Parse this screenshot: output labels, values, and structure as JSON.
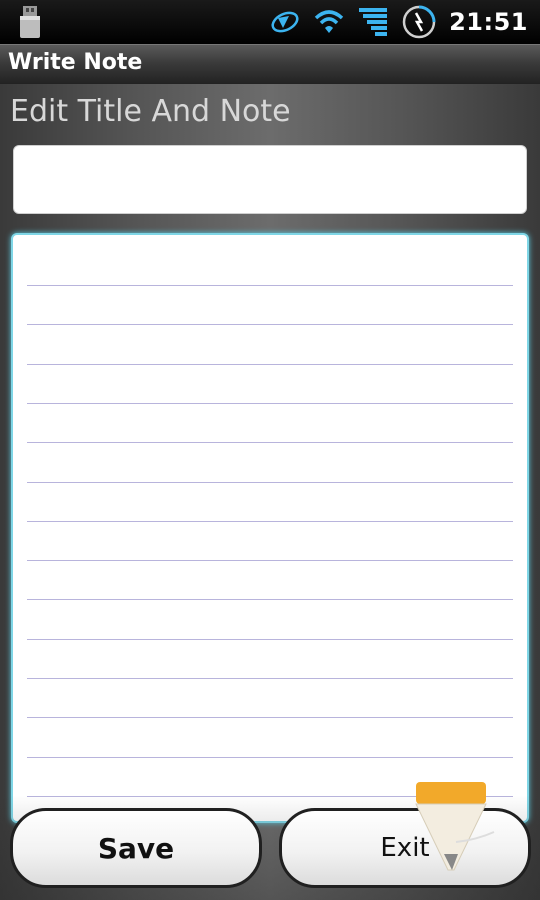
{
  "status_bar": {
    "time": "21:51",
    "icons": [
      "usb-icon",
      "sync-icon",
      "wifi-icon",
      "signal-icon",
      "battery-charging-icon"
    ]
  },
  "app": {
    "title": "Write Note"
  },
  "editor": {
    "section_label": "Edit Title And Note",
    "title_value": "",
    "note_value": ""
  },
  "buttons": {
    "save": "Save",
    "exit": "Exit"
  },
  "colors": {
    "note_border": "#7fd6e6",
    "ruled_line": "#b8b4dc",
    "status_icon_blue": "#3cb4f0"
  }
}
